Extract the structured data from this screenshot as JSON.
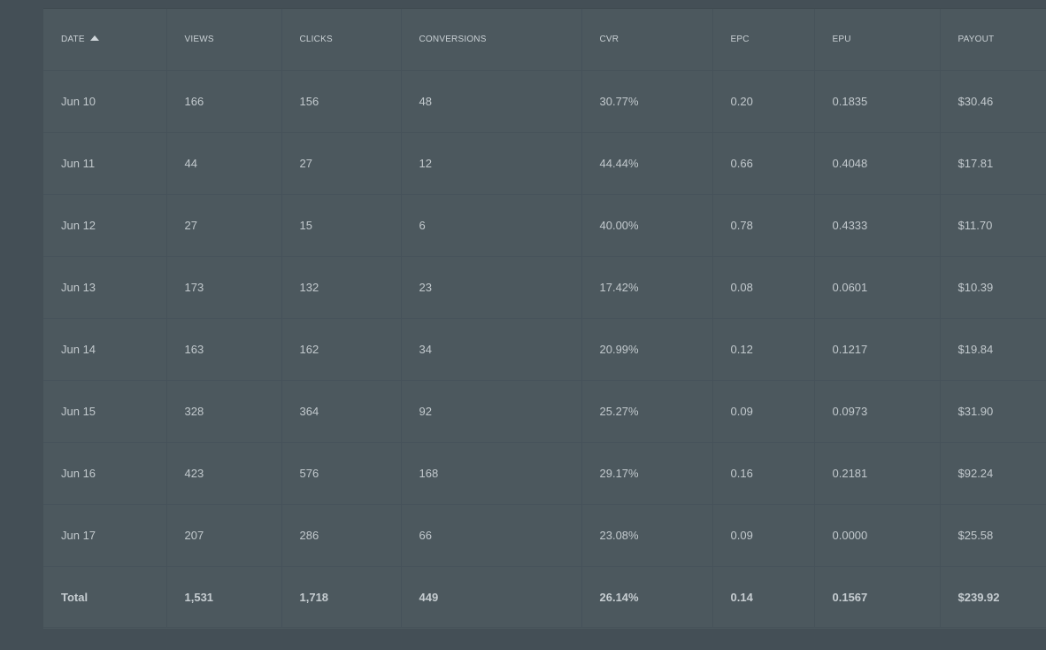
{
  "table": {
    "headers": [
      "DATE",
      "VIEWS",
      "CLICKS",
      "CONVERSIONS",
      "CVR",
      "EPC",
      "EPU",
      "PAYOUT"
    ],
    "sort": {
      "column": "DATE",
      "direction": "ascending",
      "icon": "sort-ascending-icon"
    },
    "rows": [
      [
        "Jun 10",
        "166",
        "156",
        "48",
        "30.77%",
        "0.20",
        "0.1835",
        "$30.46"
      ],
      [
        "Jun 11",
        "44",
        "27",
        "12",
        "44.44%",
        "0.66",
        "0.4048",
        "$17.81"
      ],
      [
        "Jun 12",
        "27",
        "15",
        "6",
        "40.00%",
        "0.78",
        "0.4333",
        "$11.70"
      ],
      [
        "Jun 13",
        "173",
        "132",
        "23",
        "17.42%",
        "0.08",
        "0.0601",
        "$10.39"
      ],
      [
        "Jun 14",
        "163",
        "162",
        "34",
        "20.99%",
        "0.12",
        "0.1217",
        "$19.84"
      ],
      [
        "Jun 15",
        "328",
        "364",
        "92",
        "25.27%",
        "0.09",
        "0.0973",
        "$31.90"
      ],
      [
        "Jun 16",
        "423",
        "576",
        "168",
        "29.17%",
        "0.16",
        "0.2181",
        "$92.24"
      ],
      [
        "Jun 17",
        "207",
        "286",
        "66",
        "23.08%",
        "0.09",
        "0.0000",
        "$25.58"
      ]
    ],
    "total": [
      "Total",
      "1,531",
      "1,718",
      "449",
      "26.14%",
      "0.14",
      "0.1567",
      "$239.92"
    ]
  },
  "colors": {
    "page_background": "#444f56",
    "table_background": "#4c585e",
    "text": "#c2c9cd"
  }
}
